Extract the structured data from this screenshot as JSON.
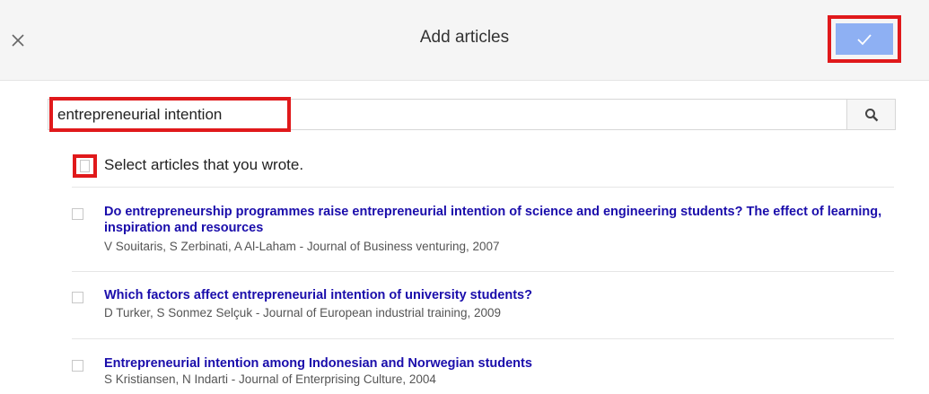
{
  "dialog": {
    "title": "Add articles",
    "close_icon": "close-icon",
    "confirm_icon": "check-icon",
    "confirm_color": "#8eb0f3",
    "highlight_color": "#e0191b"
  },
  "search": {
    "value": "entrepreneurial intention",
    "icon": "search-icon"
  },
  "own_articles": {
    "label": "Select articles that you wrote.",
    "checked": false
  },
  "articles": [
    {
      "title": "Do entrepreneurship programmes raise entrepreneurial intention of science and engineering students? The effect of learning, inspiration and resources",
      "meta": "V Souitaris, S Zerbinati, A Al-Laham - Journal of Business venturing, 2007",
      "checked": false
    },
    {
      "title": "Which factors affect entrepreneurial intention of university students?",
      "meta": "D Turker, S Sonmez Selçuk - Journal of European industrial training, 2009",
      "checked": false
    },
    {
      "title": "Entrepreneurial intention among Indonesian and Norwegian students",
      "meta": "S Kristiansen, N Indarti - Journal of Enterprising Culture, 2004",
      "checked": false
    }
  ]
}
